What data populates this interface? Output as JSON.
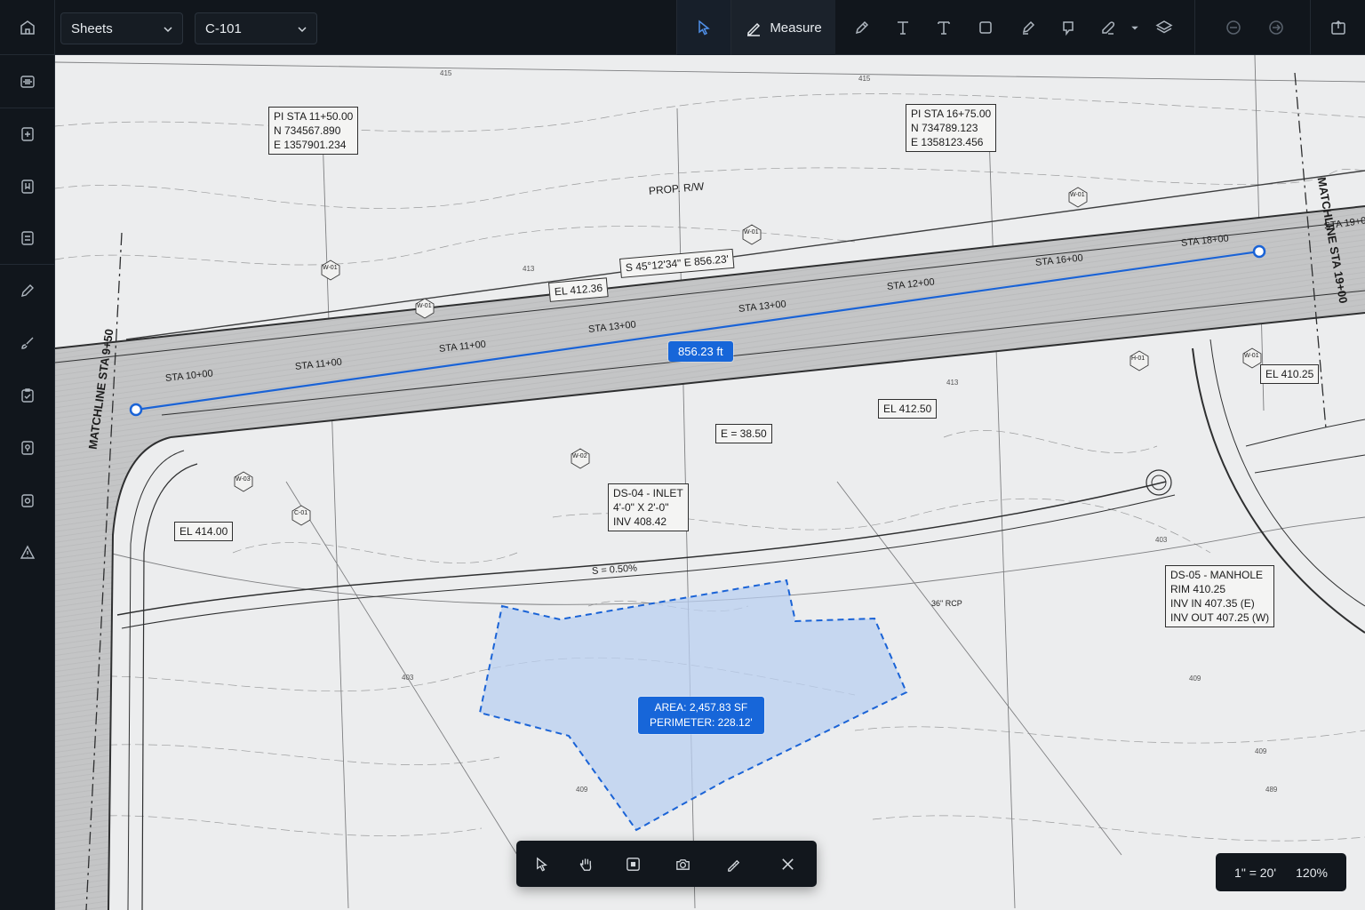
{
  "topbar": {
    "sheet_select": "Sheets",
    "drawing_select": "C-101",
    "measure_label": "Measure",
    "tools": [
      "pointer-icon",
      "pen-icon",
      "text-icon",
      "text-alt-icon",
      "rectangle-icon",
      "highlighter-icon",
      "stamp-icon",
      "eraser-icon",
      "layers-icon",
      "undo-icon",
      "redo-icon",
      "export-icon"
    ]
  },
  "leftbar": {
    "items": [
      "sheets-icon",
      "add-sheet-icon",
      "bookmark-icon",
      "compare-icon",
      "markup-icon",
      "brush-icon",
      "clipboard-icon",
      "location-icon",
      "camera-icon",
      "warning-icon"
    ]
  },
  "plan": {
    "notes": {
      "pi1": [
        "PI STA 11+50.00",
        "N 734567.890",
        "E 1357901.234"
      ],
      "pi2": [
        "PI STA 16+75.00",
        "N 734789.123",
        "E 1358123.456"
      ],
      "bearing": "S 45°12'34\" E    856.23'",
      "el_412_36": "EL 412.36",
      "el_412_50": "EL 412.50",
      "el_410_25": "EL 410.25",
      "el_414_00": "EL 414.00",
      "e_38_50": "E = 38.50",
      "ds04": [
        "DS-04 - INLET",
        "4'-0\" X 2'-0\"",
        "INV 408.42"
      ],
      "ds05": [
        "DS-05 - MANHOLE",
        "RIM 410.25",
        "INV IN 407.35 (E)",
        "INV OUT 407.25 (W)"
      ]
    },
    "labels": {
      "prop_rw": "PROP. R/W",
      "sta_10": "STA 10+00",
      "sta_11a": "STA 11+00",
      "sta_11b": "STA 11+00",
      "sta_13a": "STA 13+00",
      "sta_13b": "STA 13+00",
      "sta_12": "STA 12+00",
      "sta_16": "STA 16+00",
      "sta_18": "STA 18+00",
      "sta_19": "STA 19+0",
      "matchline_left": "MATCHLINE STA 9+50",
      "matchline_right": "MATCHLINE STA 19+00",
      "slope": "S = 0.50%",
      "rcp": "36\" RCP",
      "w01a": "W-01",
      "w01b": "W-01",
      "w01c": "W-01",
      "w01d": "W-01",
      "w01e": "W-01",
      "w02": "W-02",
      "w03": "W-03",
      "c01": "C-01",
      "h01": "H-01",
      "cont_413a": "413",
      "cont_413b": "413",
      "cont_415a": "415",
      "cont_415b": "415",
      "cont_403a": "403",
      "cont_403b": "403",
      "cont_409a": "409",
      "cont_409b": "409",
      "cont_409c": "409",
      "cont_489": "489"
    },
    "measurement": {
      "distance": "856.23 ft",
      "area_line": "AREA: 2,457.83 SF",
      "perimeter_line": "PERIMETER: 228.12'"
    }
  },
  "floatbar": {
    "tools": [
      "select-icon",
      "pan-icon",
      "stop-icon",
      "snapshot-icon",
      "calibrate-icon",
      "close-icon"
    ]
  },
  "status": {
    "scale": "1\" = 20'",
    "zoom": "120%"
  },
  "colors": {
    "accent": "#1766d9",
    "area_fill": "#b9cff0",
    "chrome": "#11161c",
    "paper": "#ecedee"
  }
}
